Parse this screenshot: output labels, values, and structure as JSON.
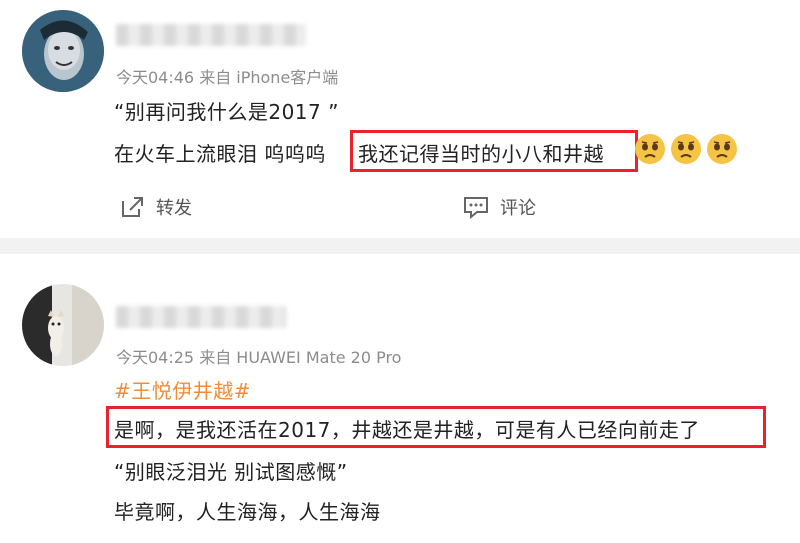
{
  "post1": {
    "meta": "今天04:46  来自 iPhone客户端",
    "line1": "“别再问我什么是2017 ”",
    "line2_prefix": "在火车上流眼泪 呜呜呜",
    "line2_highlight": "我还记得当时的小八和井越",
    "emoji": [
      "crying-face-icon",
      "crying-face-icon",
      "crying-face-icon"
    ],
    "actions": {
      "repost_label": "转发",
      "comment_label": "评论"
    }
  },
  "post2": {
    "meta": "今天04:25  来自 HUAWEI Mate 20 Pro",
    "hashtag": "#王悦伊井越#",
    "highlight_line": "是啊，是我还活在2017，井越还是井越，可是有人已经向前走了",
    "line3": "“别眼泛泪光 别试图感慨”",
    "line4": "毕竟啊，人生海海，人生海海"
  },
  "colors": {
    "highlight_border": "#e8232d",
    "hashtag": "#f28c38",
    "meta": "#8c8c8c"
  }
}
